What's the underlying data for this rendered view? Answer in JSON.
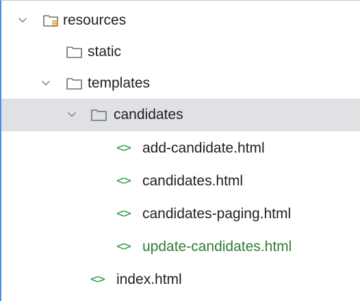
{
  "tree": {
    "resources": {
      "label": "resources",
      "icon": "resources-folder-icon",
      "expanded": true
    },
    "static": {
      "label": "static",
      "icon": "folder-icon"
    },
    "templates": {
      "label": "templates",
      "icon": "folder-icon",
      "expanded": true
    },
    "candidates": {
      "label": "candidates",
      "icon": "folder-icon",
      "expanded": true,
      "selected": true
    },
    "files": [
      {
        "label": "add-candidate.html",
        "icon": "html-icon"
      },
      {
        "label": "candidates.html",
        "icon": "html-icon"
      },
      {
        "label": "candidates-paging.html",
        "icon": "html-icon"
      },
      {
        "label": "update-candidates.html",
        "icon": "html-icon",
        "modified": true
      }
    ],
    "index": {
      "label": "index.html",
      "icon": "html-icon"
    }
  },
  "colors": {
    "html_icon": "#2a9d46",
    "modified_text": "#2e7d32",
    "selection": "#dfe1e5",
    "focus_border": "#4a90e2"
  }
}
